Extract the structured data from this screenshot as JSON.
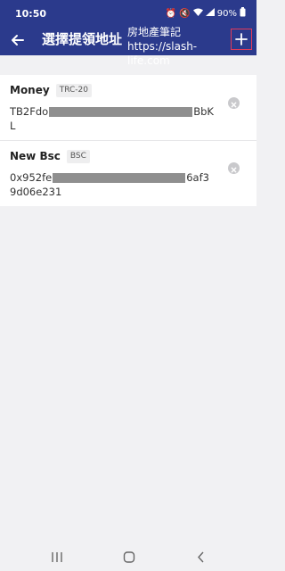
{
  "status": {
    "time": "10:50",
    "battery": "90%"
  },
  "header": {
    "title": "選擇提領地址"
  },
  "watermark": {
    "line1": "房地產筆記",
    "line2": "https://slash-life.com"
  },
  "addresses": [
    {
      "name": "Money",
      "network": "TRC-20",
      "prefix": "TB2Fdo",
      "suffix": "BbK",
      "tail": "L"
    },
    {
      "name": "New Bsc",
      "network": "BSC",
      "prefix": "0x952fe",
      "suffix": "6af3",
      "tail": "9d06e231"
    }
  ],
  "colors": {
    "header": "#2b3a8c",
    "background": "#f1f1f3",
    "highlight": "#e23b5a"
  },
  "icons": {
    "back": "arrow-left-icon",
    "add": "plus-icon",
    "remove": "clear-circle-icon"
  }
}
